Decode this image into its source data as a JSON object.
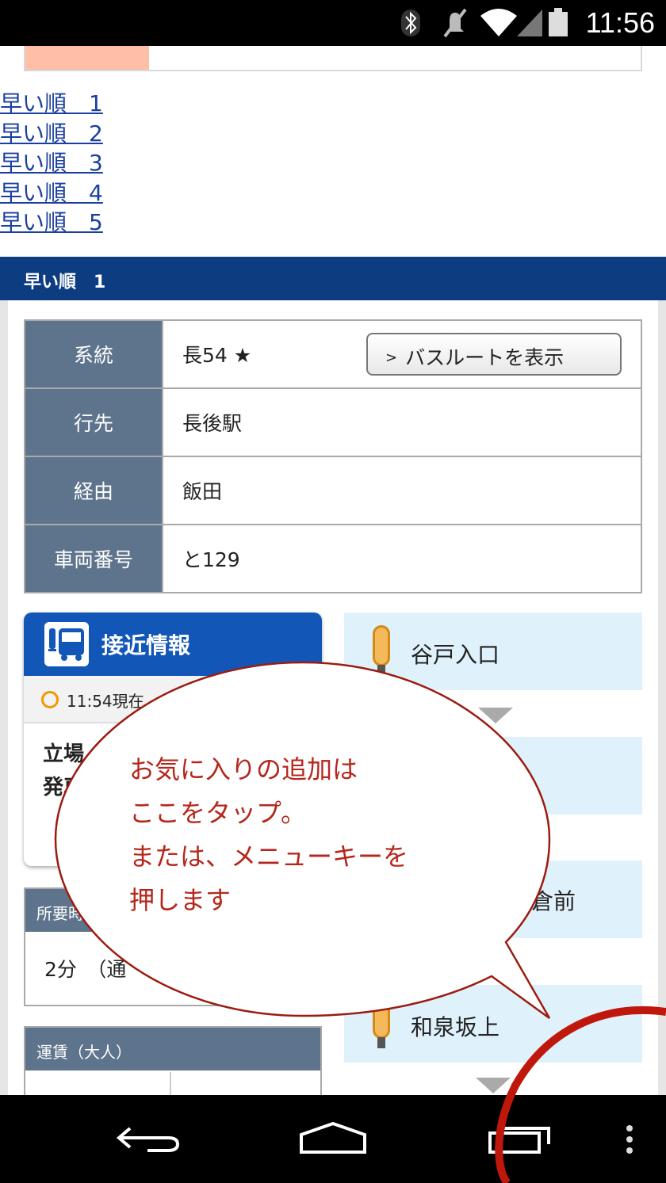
{
  "status": {
    "time": "11:56",
    "icons": [
      "bluetooth-icon",
      "mute-icon",
      "wifi-icon",
      "signal-icon",
      "battery-icon"
    ]
  },
  "links": [
    "早い順　1",
    "早い順　2",
    "早い順　3",
    "早い順　4",
    "早い順　5"
  ],
  "section": {
    "title": "早い順　1"
  },
  "info": {
    "rows": [
      {
        "label": "系統",
        "value": "長54 ★"
      },
      {
        "label": "行先",
        "value": "長後駅"
      },
      {
        "label": "経由",
        "value": "飯田"
      },
      {
        "label": "車両番号",
        "value": "と129"
      }
    ],
    "route_button": "バスルートを表示"
  },
  "approach": {
    "title": "接近情報",
    "time_label": "11:54現在",
    "body_line1": "立場",
    "body_line2": "発車"
  },
  "duration": {
    "header": "所要時",
    "value": "2分　（通"
  },
  "fare": {
    "header": "運賃（大人）"
  },
  "stops": [
    "谷戸入口",
    "",
    "倉前",
    "和泉坂上"
  ],
  "tip": {
    "lines": [
      "お気に入りの追加は",
      "ここをタップ。",
      "または、メニューキーを",
      "押します"
    ]
  },
  "colors": {
    "header_blue": "#0d3d80",
    "table_header": "#5e748c",
    "stop_bg": "#dff1fb",
    "annotation_red": "#b5271c"
  }
}
